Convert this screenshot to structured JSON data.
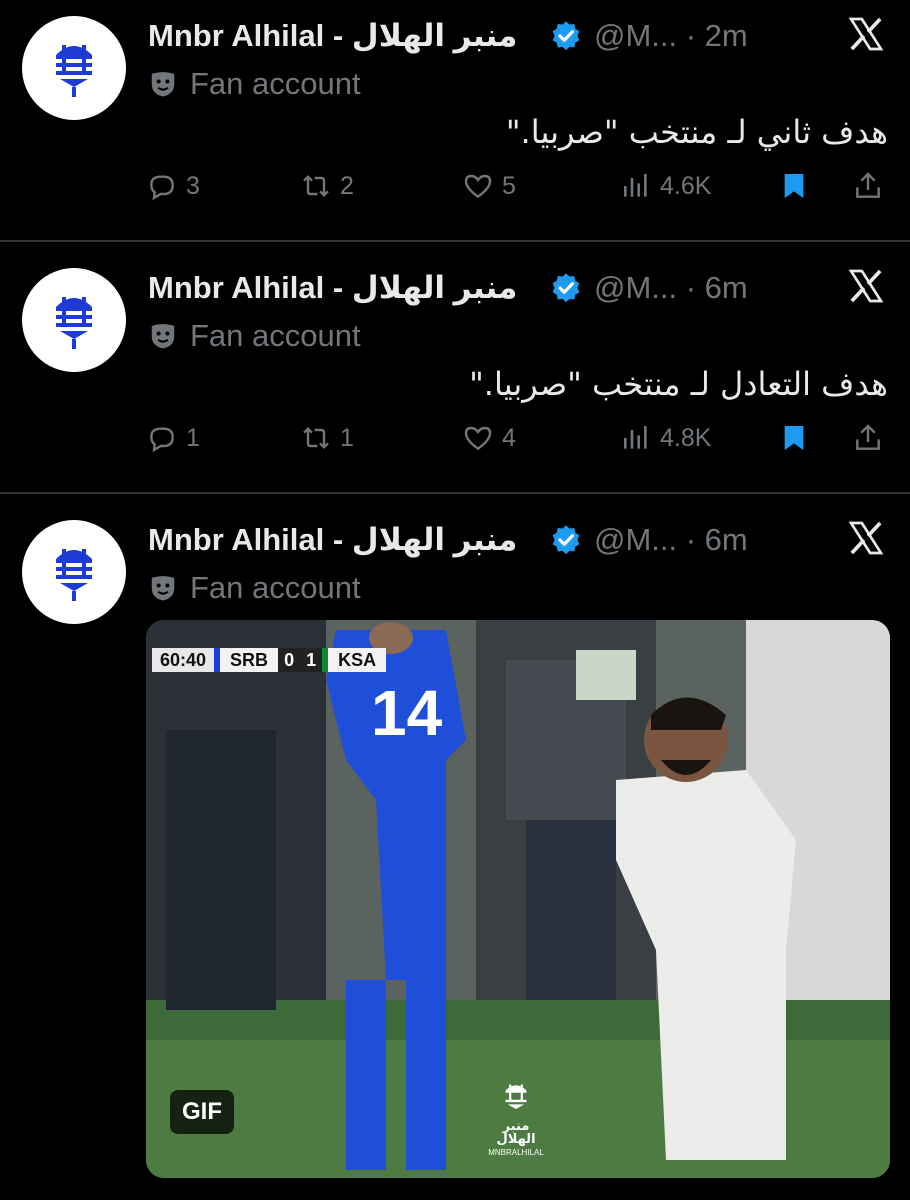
{
  "tweets": [
    {
      "name": "Mnbr Alhilal - منبر الهلال",
      "handle": "@M... · 2m",
      "badge": "Fan account",
      "text": "هدف ثاني لـ منتخب \"صربيا.\"",
      "replies": "3",
      "reposts": "2",
      "likes": "5",
      "views": "4.6K"
    },
    {
      "name": "Mnbr Alhilal - منبر الهلال",
      "handle": "@M... · 6m",
      "badge": "Fan account",
      "text": "هدف التعادل لـ منتخب \"صربيا.\"",
      "replies": "1",
      "reposts": "1",
      "likes": "4",
      "views": "4.8K"
    },
    {
      "name": "Mnbr Alhilal - منبر الهلال",
      "handle": "@M... · 6m",
      "badge": "Fan account",
      "media": {
        "gif_label": "GIF",
        "clock": "60:40",
        "team_home": "SRB",
        "score_home": "0",
        "score_away": "1",
        "team_away": "KSA",
        "jersey_number": "14",
        "watermark_ar": "منبر الهلال",
        "watermark_en": "MNBRALHILAL"
      }
    }
  ],
  "colors": {
    "background": "#000000",
    "text": "#e7e9ea",
    "muted": "#71767b",
    "verified": "#1d9bf0",
    "bookmark": "#1d9bf0",
    "brand_blue": "#1e3bd6"
  }
}
